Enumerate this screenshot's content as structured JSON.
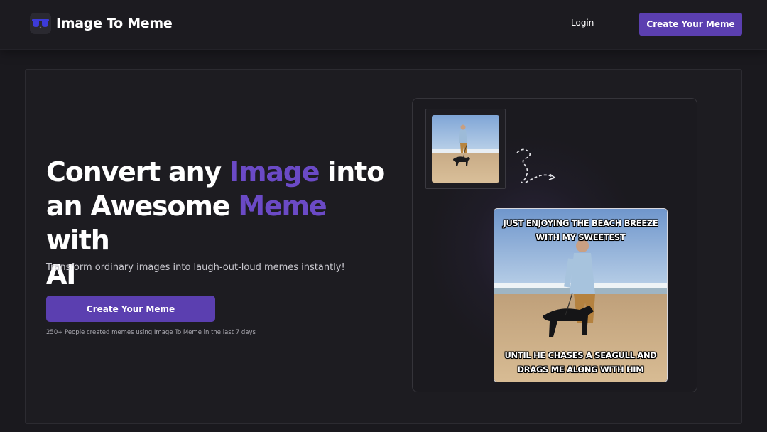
{
  "header": {
    "brand": "Image To Meme",
    "logo_icon": "sunglasses-icon",
    "login_label": "Login",
    "cta_label": "Create Your Meme"
  },
  "hero": {
    "headline": {
      "line1_a": "Convert any ",
      "line1_accent": "Image",
      "line1_b": " into",
      "line2_a": "an Awesome ",
      "line2_accent": "Meme",
      "line2_b": " with",
      "line3": "AI"
    },
    "subtitle": "Transform ordinary images into laugh-out-loud memes instantly!",
    "cta_label": "Create Your Meme",
    "social_proof": "250+ People created memes using Image To Meme in the last 7 days"
  },
  "demo": {
    "source_image": "man-walking-dog-on-beach-photo",
    "arrow_icon": "dashed-curly-arrow-icon",
    "meme_top": "JUST ENJOYING THE BEACH BREEZE WITH MY SWEETEST",
    "meme_bottom": "UNTIL HE CHASES A SEAGULL AND DRAGS ME ALONG WITH HIM"
  },
  "colors": {
    "accent": "#5b3fb0",
    "accent_text": "#6b4ac6",
    "background": "#1a191e"
  }
}
